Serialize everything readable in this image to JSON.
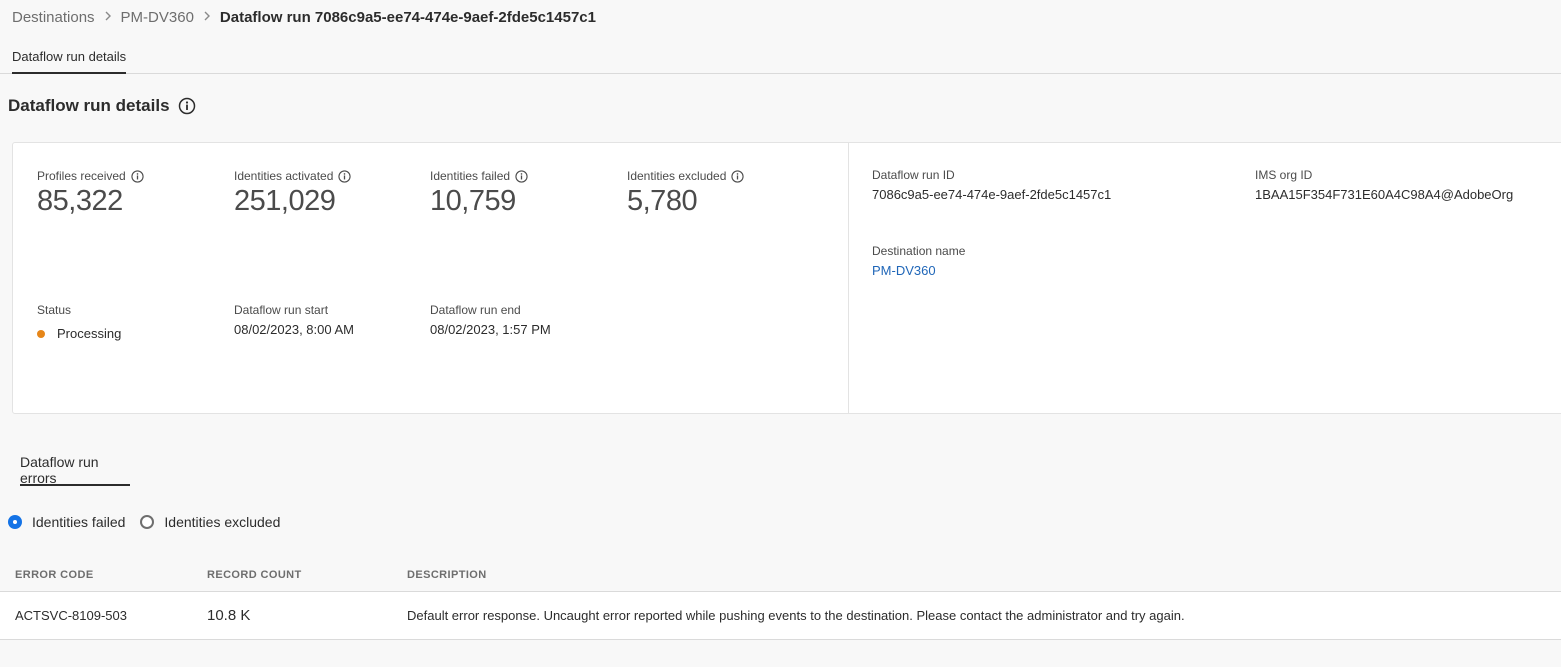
{
  "breadcrumb": {
    "items": [
      "Destinations",
      "PM-DV360"
    ],
    "current": "Dataflow run 7086c9a5-ee74-474e-9aef-2fde5c1457c1"
  },
  "top_tab": "Dataflow run details",
  "section_title": "Dataflow run details",
  "metrics": [
    {
      "label": "Profiles received",
      "value": "85,322"
    },
    {
      "label": "Identities activated",
      "value": "251,029"
    },
    {
      "label": "Identities failed",
      "value": "10,759"
    },
    {
      "label": "Identities excluded",
      "value": "5,780"
    }
  ],
  "status": {
    "label": "Status",
    "value": "Processing",
    "color": "#e68619"
  },
  "run_start": {
    "label": "Dataflow run start",
    "value": "08/02/2023, 8:00 AM"
  },
  "run_end": {
    "label": "Dataflow run end",
    "value": "08/02/2023, 1:57 PM"
  },
  "run_id": {
    "label": "Dataflow run ID",
    "value": "7086c9a5-ee74-474e-9aef-2fde5c1457c1"
  },
  "ims_org": {
    "label": "IMS org ID",
    "value": "1BAA15F354F731E60A4C98A4@AdobeOrg"
  },
  "destination": {
    "label": "Destination name",
    "value": "PM-DV360"
  },
  "errors_tab": "Dataflow run errors",
  "radios": [
    {
      "label": "Identities failed",
      "selected": true
    },
    {
      "label": "Identities excluded",
      "selected": false
    }
  ],
  "table": {
    "headers": [
      "ERROR CODE",
      "RECORD COUNT",
      "DESCRIPTION"
    ],
    "rows": [
      {
        "code": "ACTSVC-8109-503",
        "count": "10.8 K",
        "description": "Default error response. Uncaught error reported while pushing events to the destination. Please contact the administrator and try again."
      }
    ]
  },
  "colors": {
    "accent": "#1473e6",
    "link": "#1f66b8",
    "status_processing": "#e68619"
  }
}
